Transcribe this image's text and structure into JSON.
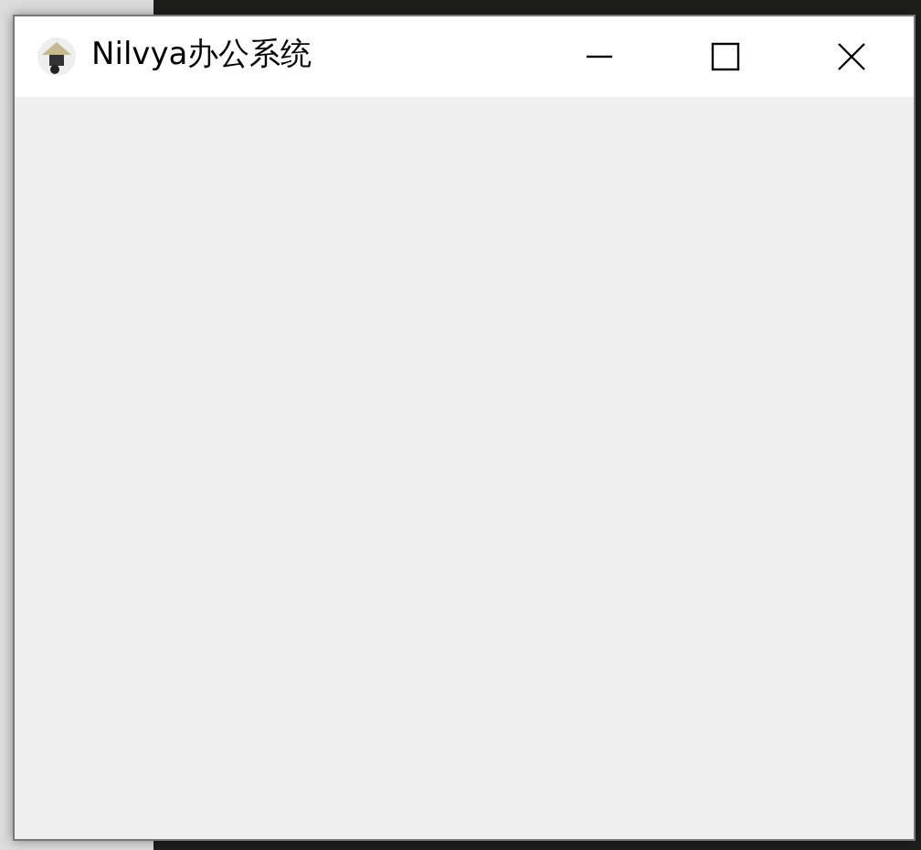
{
  "window": {
    "title": "Nilvya办公系统"
  }
}
